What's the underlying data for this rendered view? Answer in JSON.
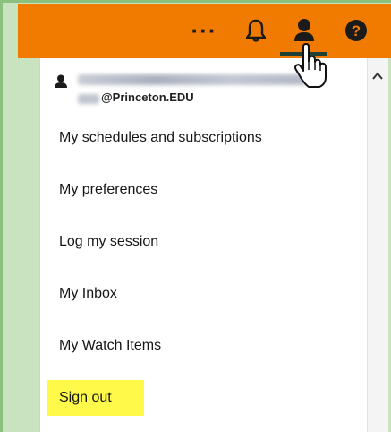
{
  "header": {
    "more_label": "···",
    "icons": [
      "more-icon",
      "bell-icon",
      "user-icon",
      "help-icon"
    ],
    "help_label": "?",
    "color": "#f07b00"
  },
  "account": {
    "email_suffix": "@Princeton.EDU"
  },
  "menu": {
    "items": [
      {
        "label": "My schedules and subscriptions"
      },
      {
        "label": "My preferences"
      },
      {
        "label": "Log my session"
      },
      {
        "label": "My Inbox"
      },
      {
        "label": "My Watch Items"
      },
      {
        "label": "Sign out"
      }
    ],
    "highlight_color": "#fff94a"
  }
}
